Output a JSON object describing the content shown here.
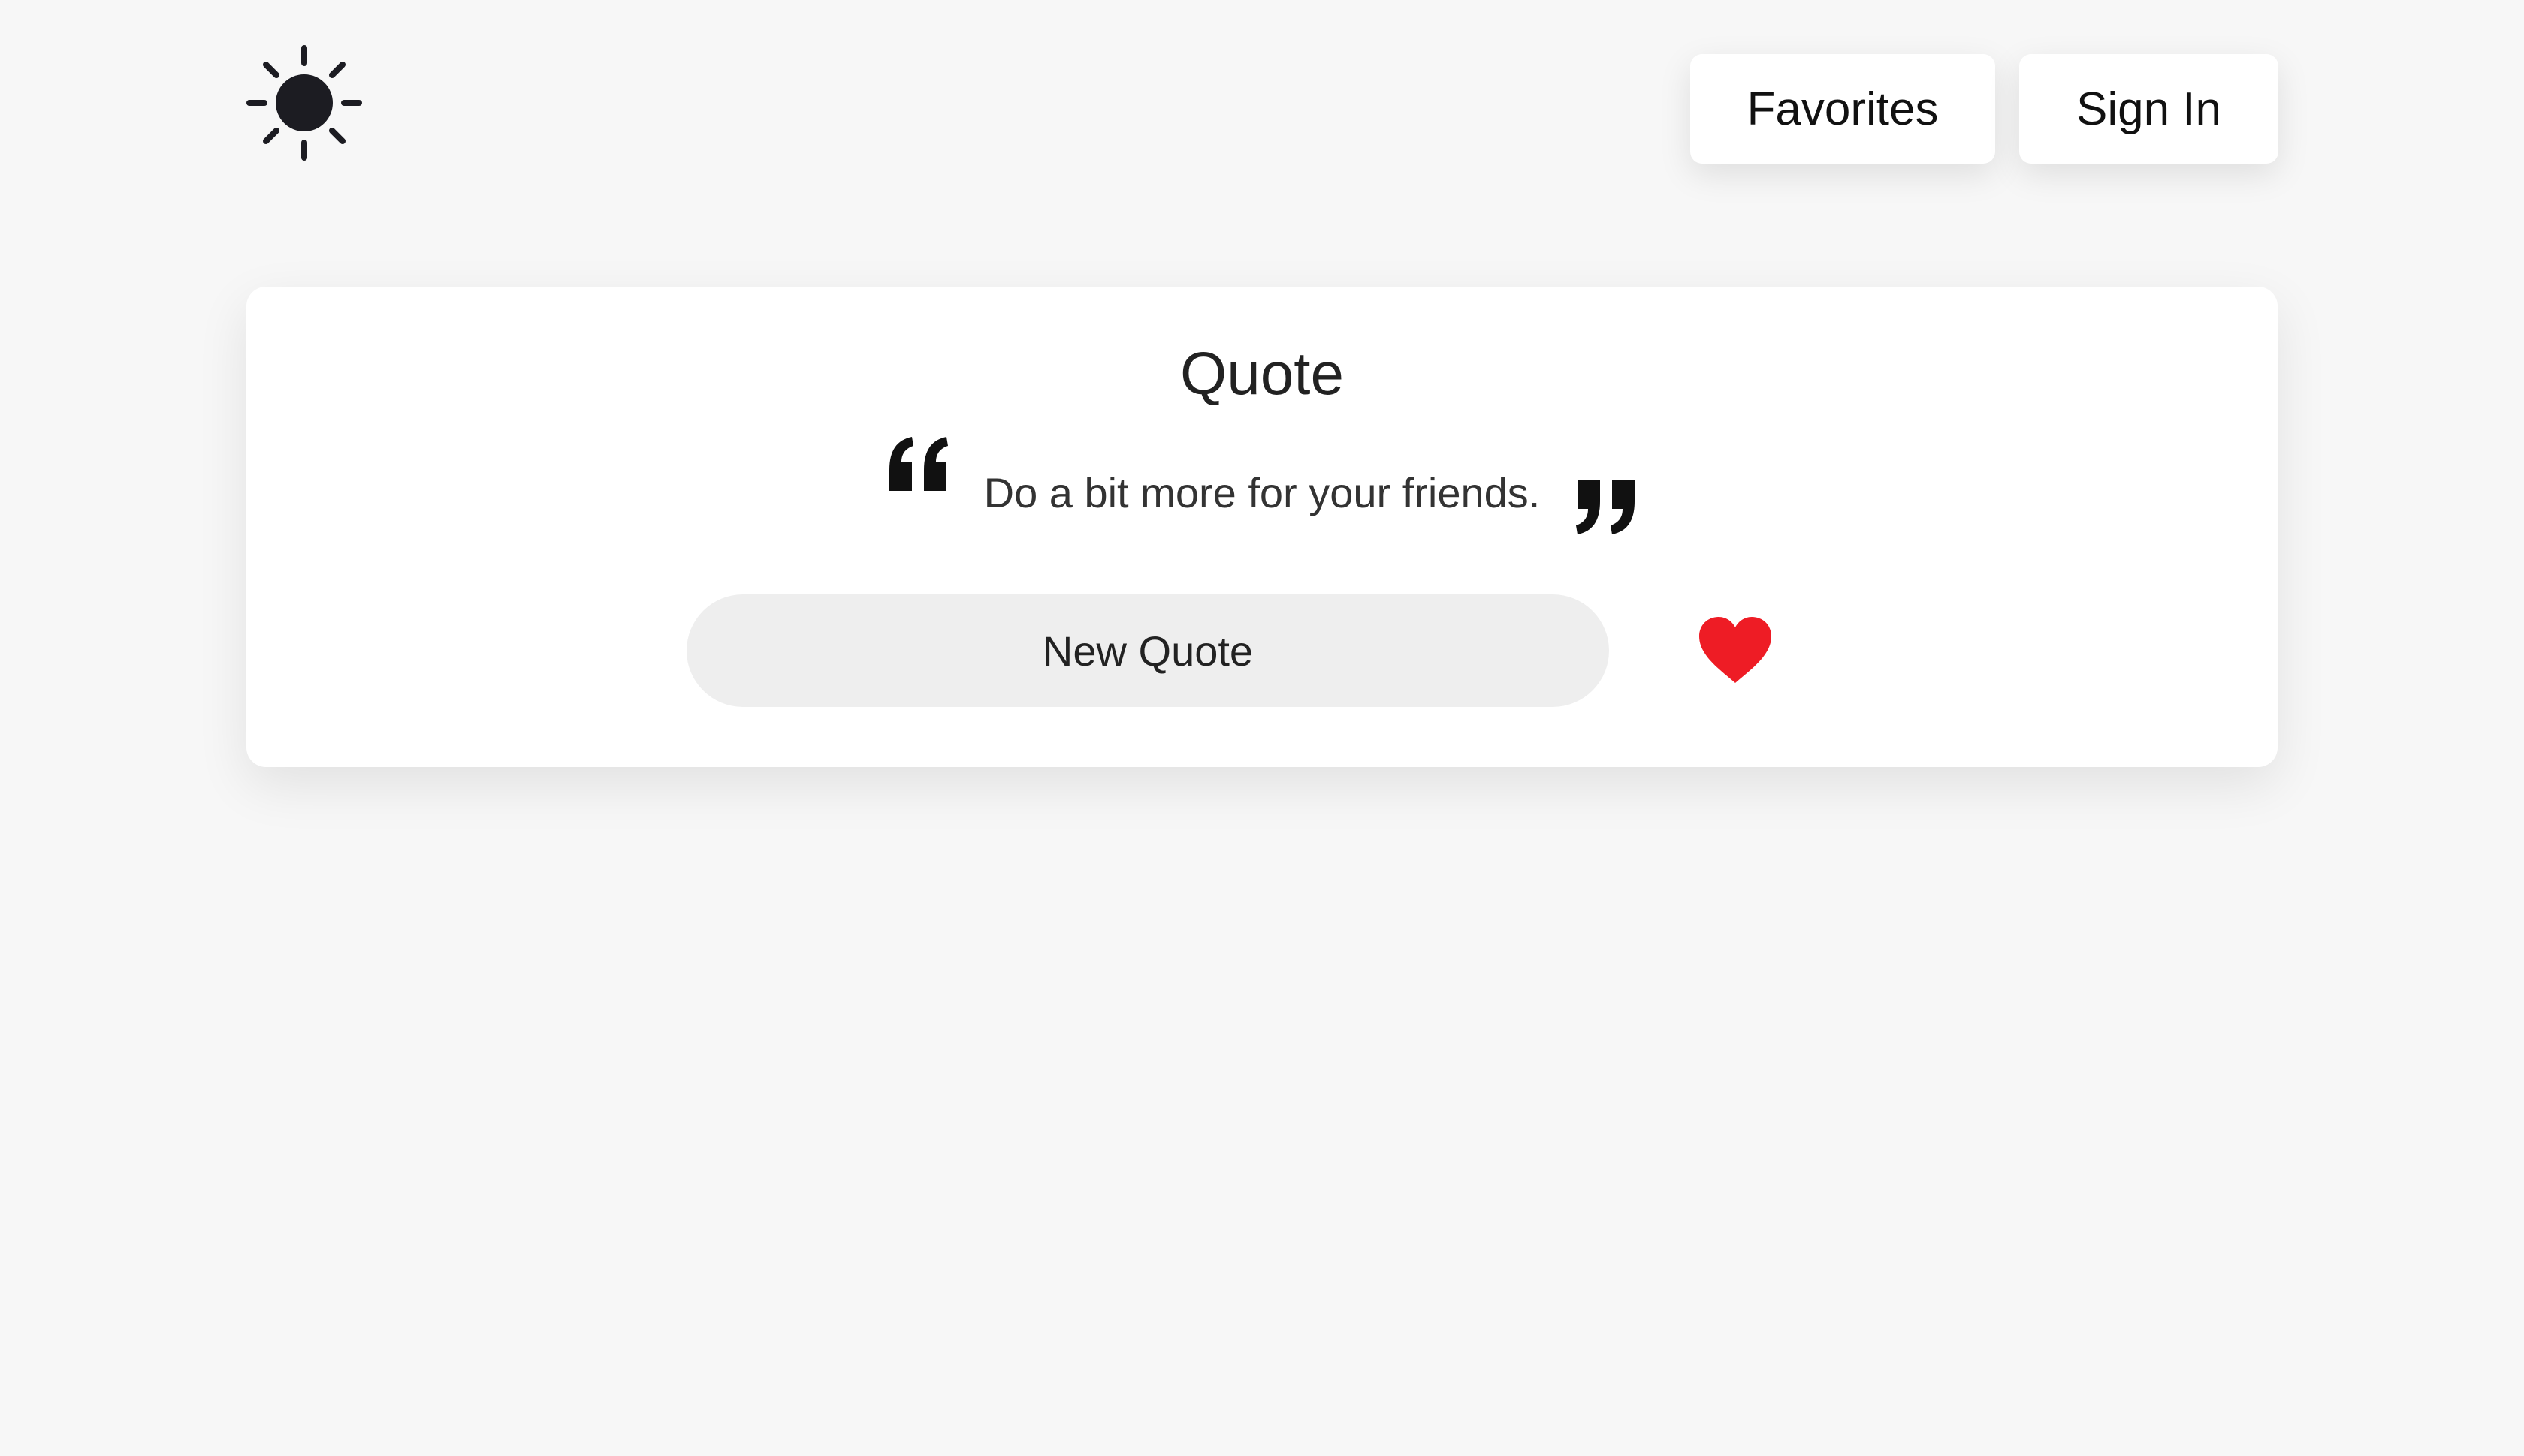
{
  "header": {
    "theme_toggle_icon": "sun-icon",
    "nav": {
      "favorites_label": "Favorites",
      "sign_in_label": "Sign In"
    }
  },
  "quote_card": {
    "title": "Quote",
    "open_quote_icon": "open-quote-icon",
    "close_quote_icon": "close-quote-icon",
    "text": "Do a bit more for your friends.",
    "new_quote_label": "New Quote",
    "favorite_icon": "heart-icon",
    "favorite_color": "#ee1c25"
  },
  "colors": {
    "background": "#f7f7f7",
    "card": "#ffffff",
    "button_secondary": "#eeeeee",
    "text": "#222222",
    "icon": "#1c1c22"
  }
}
